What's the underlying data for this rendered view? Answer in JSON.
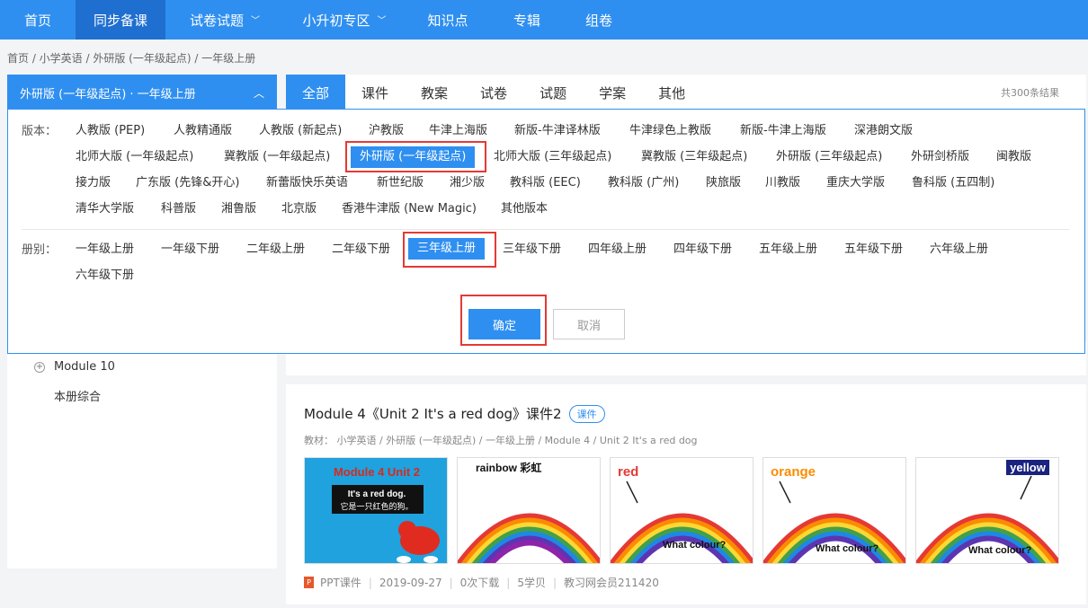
{
  "nav": {
    "items": [
      {
        "label": "首页"
      },
      {
        "label": "同步备课"
      },
      {
        "label": "试卷试题"
      },
      {
        "label": "小升初专区"
      },
      {
        "label": "知识点"
      },
      {
        "label": "专辑"
      },
      {
        "label": "组卷"
      }
    ]
  },
  "breadcrumb": "首页 / 小学英语 / 外研版 (一年级起点) / 一年级上册",
  "sidebar": {
    "select_label": "外研版 (一年级起点) · 一年级上册",
    "items": [
      {
        "label": "Module 10"
      },
      {
        "label": "本册综合"
      }
    ]
  },
  "tabs": [
    {
      "label": "全部"
    },
    {
      "label": "课件"
    },
    {
      "label": "教案"
    },
    {
      "label": "试卷"
    },
    {
      "label": "试题"
    },
    {
      "label": "学案"
    },
    {
      "label": "其他"
    }
  ],
  "total": "共300条结果",
  "panel": {
    "edition_label": "版本：",
    "volume_label": "册别：",
    "editions": [
      "人教版 (PEP)",
      "人教精通版",
      "人教版 (新起点)",
      "沪教版",
      "牛津上海版",
      "新版-牛津译林版",
      "牛津绿色上教版",
      "新版-牛津上海版",
      "深港朗文版",
      "北师大版 (一年级起点)",
      "冀教版 (一年级起点)",
      "外研版 (一年级起点)",
      "北师大版 (三年级起点)",
      "冀教版 (三年级起点)",
      "外研版 (三年级起点)",
      "外研剑桥版",
      "闽教版",
      "接力版",
      "广东版 (先锋&开心)",
      "新蕾版快乐英语",
      "新世纪版",
      "湘少版",
      "教科版 (EEC)",
      "教科版 (广州)",
      "陕旅版",
      "川教版",
      "重庆大学版",
      "鲁科版 (五四制)",
      "清华大学版",
      "科普版",
      "湘鲁版",
      "北京版",
      "香港牛津版 (New Magic)",
      "其他版本"
    ],
    "volumes": [
      "一年级上册",
      "一年级下册",
      "二年级上册",
      "二年级下册",
      "三年级上册",
      "三年级下册",
      "四年级上册",
      "四年级下册",
      "五年级上册",
      "五年级下册",
      "六年级上册",
      "六年级下册"
    ],
    "confirm": "确定",
    "cancel": "取消"
  },
  "card": {
    "title": "Module 4《Unit 2 It's a red dog》课件2",
    "badge": "课件",
    "path": "教材：  小学英语 / 外研版 (一年级起点) / 一年级上册 / Module 4 / Unit 2 It's a red dog",
    "thumbs": [
      {
        "title": "Module 4 Unit 2",
        "line1": "It's a red dog.",
        "line2": "它是一只红色的狗。"
      },
      {
        "word": "rainbow 彩虹"
      },
      {
        "word": "red",
        "q": "What colour?"
      },
      {
        "word": "orange",
        "q": "What colour?"
      },
      {
        "word": "yellow",
        "q": "What colour?"
      }
    ],
    "meta": {
      "type": "PPT课件",
      "date": "2019-09-27",
      "downloads": "0次下载",
      "coins": "5学贝",
      "author": "教习网会员211420"
    }
  }
}
